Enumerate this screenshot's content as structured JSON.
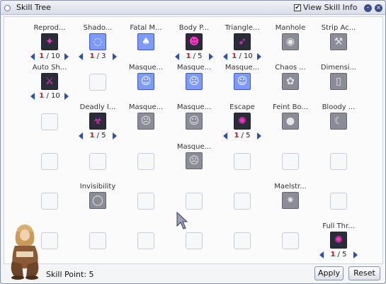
{
  "window": {
    "title": "Skill Tree",
    "view_skill_info_label": "View Skill Info",
    "view_skill_info_checked": true,
    "minimize_glyph": "–",
    "close_glyph": "×"
  },
  "skills": [
    {
      "col": 0,
      "row": 0,
      "label": "Reprod...",
      "state": "active",
      "icon": "reproduce-icon",
      "glyph": "✦",
      "level": "1",
      "max": "/ 10"
    },
    {
      "col": 1,
      "row": 0,
      "label": "Shado...",
      "state": "available",
      "icon": "shadow-form-icon",
      "glyph": "◌",
      "level": "1",
      "max": "/ 3"
    },
    {
      "col": 2,
      "row": 0,
      "label": "Fatal M...",
      "state": "available",
      "icon": "fatal-menace-icon",
      "glyph": "♠"
    },
    {
      "col": 3,
      "row": 0,
      "label": "Body P...",
      "state": "active",
      "icon": "body-painting-icon",
      "glyph": "☻",
      "level": "1",
      "max": "/ 5"
    },
    {
      "col": 4,
      "row": 0,
      "label": "Triangle...",
      "state": "active",
      "icon": "triangle-shot-icon",
      "glyph": "➶",
      "level": "1",
      "max": "/ 10"
    },
    {
      "col": 5,
      "row": 0,
      "label": "Manhole",
      "state": "locked",
      "icon": "manhole-icon",
      "glyph": "◉"
    },
    {
      "col": 6,
      "row": 0,
      "label": "Strip Ac...",
      "state": "locked",
      "icon": "strip-accessory-icon",
      "glyph": "⚒"
    },
    {
      "col": 0,
      "row": 1,
      "label": "Auto Sh...",
      "state": "active",
      "icon": "auto-shadow-spell-icon",
      "glyph": "⚔",
      "level": "1",
      "max": "/ 10"
    },
    {
      "col": 1,
      "row": 1,
      "label": "",
      "state": "empty"
    },
    {
      "col": 2,
      "row": 1,
      "label": "Masque...",
      "state": "available",
      "icon": "masquerade-enervation-icon",
      "glyph": "☺"
    },
    {
      "col": 3,
      "row": 1,
      "label": "Masque...",
      "state": "available",
      "icon": "masquerade-groomy-icon",
      "glyph": "☹"
    },
    {
      "col": 4,
      "row": 1,
      "label": "Masque...",
      "state": "available",
      "icon": "masquerade-ignorance-icon",
      "glyph": "☺"
    },
    {
      "col": 5,
      "row": 1,
      "label": "Chaos ...",
      "state": "locked",
      "icon": "chaos-panic-icon",
      "glyph": "✿"
    },
    {
      "col": 6,
      "row": 1,
      "label": "Dimensi...",
      "state": "locked",
      "icon": "dimension-door-icon",
      "glyph": "▯"
    },
    {
      "col": 0,
      "row": 2,
      "label": "",
      "state": "empty"
    },
    {
      "col": 1,
      "row": 2,
      "label": "Deadly I...",
      "state": "active",
      "icon": "deadly-infect-icon",
      "glyph": "☣",
      "level": "1",
      "max": "/ 5"
    },
    {
      "col": 2,
      "row": 2,
      "label": "Masque...",
      "state": "locked",
      "icon": "masquerade-laziness-icon",
      "glyph": "☹"
    },
    {
      "col": 3,
      "row": 2,
      "label": "Masque...",
      "state": "locked",
      "icon": "masquerade-unlucky-icon",
      "glyph": "☺"
    },
    {
      "col": 4,
      "row": 2,
      "label": "Escape",
      "state": "active",
      "icon": "escape-icon",
      "glyph": "✺",
      "level": "1",
      "max": "/ 5"
    },
    {
      "col": 5,
      "row": 2,
      "label": "Feint Bo...",
      "state": "locked",
      "icon": "feint-bomb-icon",
      "glyph": "●"
    },
    {
      "col": 6,
      "row": 2,
      "label": "Bloody ...",
      "state": "locked",
      "icon": "bloody-lust-icon",
      "glyph": "☾"
    },
    {
      "col": 0,
      "row": 3,
      "label": "",
      "state": "empty"
    },
    {
      "col": 1,
      "row": 3,
      "label": "",
      "state": "empty"
    },
    {
      "col": 2,
      "row": 3,
      "label": "",
      "state": "empty"
    },
    {
      "col": 3,
      "row": 3,
      "label": "Masque...",
      "state": "locked",
      "icon": "masquerade-weakness-icon",
      "glyph": "☹"
    },
    {
      "col": 4,
      "row": 3,
      "label": "",
      "state": "empty"
    },
    {
      "col": 5,
      "row": 3,
      "label": "",
      "state": "empty"
    },
    {
      "col": 6,
      "row": 3,
      "label": "",
      "state": "empty"
    },
    {
      "col": 0,
      "row": 4,
      "label": "",
      "state": "empty"
    },
    {
      "col": 1,
      "row": 4,
      "label": "Invisibility",
      "state": "locked",
      "icon": "invisibility-icon",
      "glyph": "◯"
    },
    {
      "col": 2,
      "row": 4,
      "label": "",
      "state": "empty"
    },
    {
      "col": 3,
      "row": 4,
      "label": "",
      "state": "empty"
    },
    {
      "col": 4,
      "row": 4,
      "label": "",
      "state": "empty"
    },
    {
      "col": 5,
      "row": 4,
      "label": "Maelstr...",
      "state": "locked",
      "icon": "maelstrom-icon",
      "glyph": "✷"
    },
    {
      "col": 6,
      "row": 4,
      "label": "",
      "state": "empty"
    },
    {
      "col": 0,
      "row": 5,
      "label": "",
      "state": "empty"
    },
    {
      "col": 1,
      "row": 5,
      "label": "",
      "state": "empty"
    },
    {
      "col": 2,
      "row": 5,
      "label": "",
      "state": "empty"
    },
    {
      "col": 3,
      "row": 5,
      "label": "",
      "state": "empty"
    },
    {
      "col": 4,
      "row": 5,
      "label": "",
      "state": "empty"
    },
    {
      "col": 5,
      "row": 5,
      "label": "",
      "state": "empty"
    },
    {
      "col": 6,
      "row": 5,
      "label": "Full Thr...",
      "state": "active",
      "icon": "full-throttle-icon",
      "glyph": "✺",
      "level": "1",
      "max": "/ 5"
    }
  ],
  "footer": {
    "skill_point_label": "Skill Point: 5",
    "apply_label": "Apply",
    "reset_label": "Reset"
  },
  "colors": {
    "level_current": "#d0142c",
    "arrow": "#2f4fb0",
    "available_icon": "#7d9bff"
  }
}
